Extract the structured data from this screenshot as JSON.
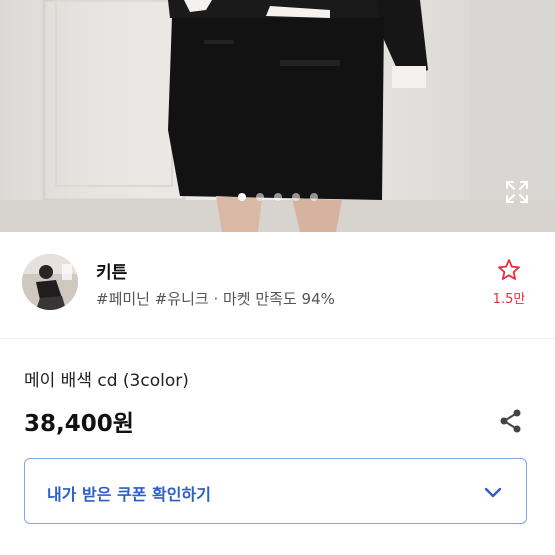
{
  "hero": {
    "image_label": "product-photo",
    "slide_count": 5,
    "active_slide": 1
  },
  "seller": {
    "name": "키튼",
    "tags": "#페미닌 #유니크 · 마켓 만족도 94%",
    "favorite_count": "1.5만"
  },
  "product": {
    "title": "메이 배색 cd (3color)",
    "price": "38,400원"
  },
  "coupon": {
    "label": "내가 받은 쿠폰 확인하기"
  },
  "colors": {
    "accent_blue": "#2d5fc4",
    "coupon_border": "#7fa7e4",
    "favorite_red": "#e8303f"
  }
}
